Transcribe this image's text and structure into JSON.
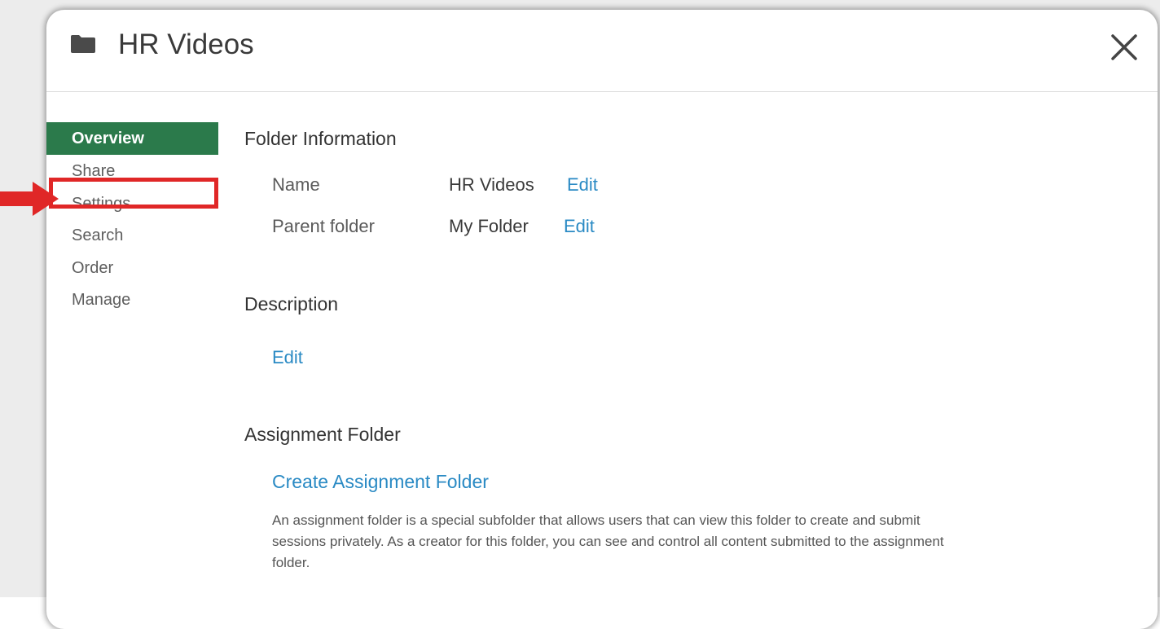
{
  "dialog": {
    "title": "HR Videos",
    "folder_icon": "folder-icon",
    "close_icon": "close-icon"
  },
  "sidebar": {
    "items": [
      {
        "label": "Overview",
        "active": true
      },
      {
        "label": "Share"
      },
      {
        "label": "Settings",
        "highlighted": true
      },
      {
        "label": "Search"
      },
      {
        "label": "Order"
      },
      {
        "label": "Manage"
      }
    ]
  },
  "folder_info": {
    "heading": "Folder Information",
    "name_label": "Name",
    "name_value": "HR Videos",
    "name_edit": "Edit",
    "parent_label": "Parent folder",
    "parent_value": "My Folder",
    "parent_edit": "Edit"
  },
  "description": {
    "heading": "Description",
    "edit": "Edit"
  },
  "assignment": {
    "heading": "Assignment Folder",
    "create_link": "Create Assignment Folder",
    "text": "An assignment folder is a special subfolder that allows users that can view this folder to create and submit sessions privately. As a creator for this folder, you can see and control all content submitted to the assignment folder."
  },
  "colors": {
    "active_nav": "#2b7a4b",
    "link": "#2a8ac4",
    "annotation": "#e02727"
  }
}
